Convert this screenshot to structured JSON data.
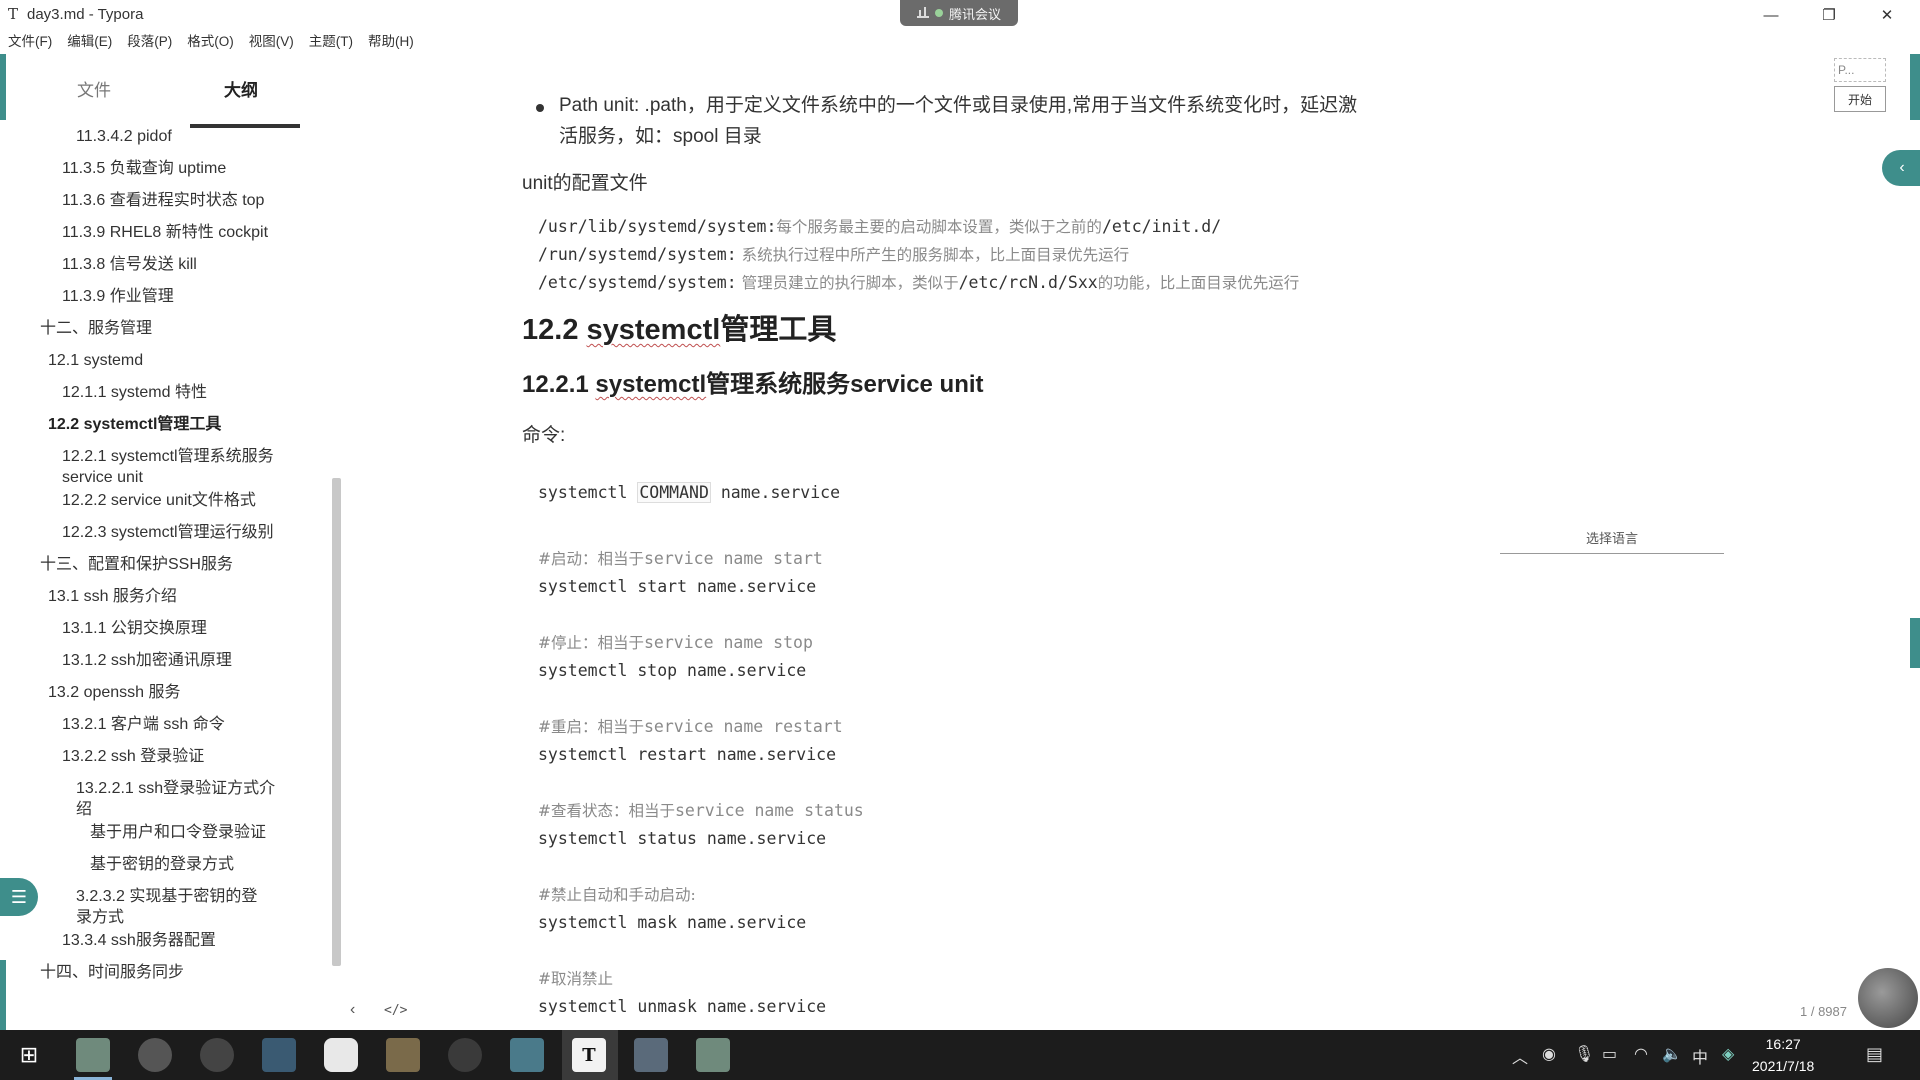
{
  "window": {
    "app_icon": "T",
    "title": "day3.md - Typora",
    "meeting_badge": "腾讯会议",
    "minimize": "—",
    "maximize": "❐",
    "close": "✕"
  },
  "menu": [
    "文件(F)",
    "编辑(E)",
    "段落(P)",
    "格式(O)",
    "视图(V)",
    "主题(T)",
    "帮助(H)"
  ],
  "sidebar": {
    "tab_files": "文件",
    "tab_outline": "大纲",
    "toggle_icon": "☰",
    "nav_back": "‹",
    "nav_code": "</>",
    "items": [
      {
        "label": "11.3.4.2 pidof",
        "level": 4,
        "bold": false
      },
      {
        "label": "11.3.5 负载查询 uptime",
        "level": 3,
        "bold": false
      },
      {
        "label": "11.3.6 查看进程实时状态 top",
        "level": 3,
        "bold": false
      },
      {
        "label": "11.3.9 RHEL8 新特性 cockpit",
        "level": 3,
        "bold": false
      },
      {
        "label": "11.3.8 信号发送 kill",
        "level": 3,
        "bold": false
      },
      {
        "label": "11.3.9 作业管理",
        "level": 3,
        "bold": false
      },
      {
        "label": "十二、服务管理",
        "level": 1,
        "bold": false
      },
      {
        "label": "12.1 systemd",
        "level": 2,
        "bold": false
      },
      {
        "label": "12.1.1 systemd 特性",
        "level": 3,
        "bold": false
      },
      {
        "label": "12.2 systemctl管理工具",
        "level": 2,
        "bold": true
      },
      {
        "label": "12.2.1 systemctl管理系统服务",
        "label2": "service unit",
        "level": 3,
        "bold": false
      },
      {
        "label": "12.2.2 service unit文件格式",
        "level": 3,
        "bold": false
      },
      {
        "label": "12.2.3 systemctl管理运行级别",
        "level": 3,
        "bold": false
      },
      {
        "label": "十三、配置和保护SSH服务",
        "level": 1,
        "bold": false
      },
      {
        "label": "13.1 ssh 服务介绍",
        "level": 2,
        "bold": false
      },
      {
        "label": "13.1.1 公钥交换原理",
        "level": 3,
        "bold": false
      },
      {
        "label": "13.1.2 ssh加密通讯原理",
        "level": 3,
        "bold": false
      },
      {
        "label": "13.2 openssh 服务",
        "level": 2,
        "bold": false
      },
      {
        "label": "13.2.1 客户端 ssh 命令",
        "level": 3,
        "bold": false
      },
      {
        "label": "13.2.2 ssh 登录验证",
        "level": 3,
        "bold": false
      },
      {
        "label": "13.2.2.1 ssh登录验证方式介",
        "label2": "绍",
        "level": 4,
        "bold": false
      },
      {
        "label": "基于用户和口令登录验证",
        "level": 5,
        "bold": false
      },
      {
        "label": "基于密钥的登录方式",
        "level": 5,
        "bold": false
      },
      {
        "label": "3.2.3.2 实现基于密钥的登",
        "label2": "录方式",
        "level": 4,
        "bold": false
      },
      {
        "label": "13.3.4 ssh服务器配置",
        "level": 3,
        "bold": false
      },
      {
        "label": "十四、时间服务同步",
        "level": 1,
        "bold": false
      }
    ]
  },
  "doc": {
    "bullet_line1": "Path unit: .path，用于定义文件系统中的一个文件或目录使用,常用于当文件系统变化时，延迟激",
    "bullet_line2": "活服务，如：spool 目录",
    "unit_config_title": "unit的配置文件",
    "config_lines": [
      {
        "path": "/usr/lib/systemd/system:",
        "comment": "每个服务最主要的启动脚本设置，类似于之前的",
        "tail": "/etc/init.d/",
        "tail_comment": ""
      },
      {
        "path": "/run/systemd/system:",
        "comment": " 系统执行过程中所产生的服务脚本，比上面目录优先运行",
        "tail": "",
        "tail_comment": ""
      },
      {
        "path": "/etc/systemd/system:",
        "comment": " 管理员建立的执行脚本，类似于",
        "tail": "/etc/rcN.d/Sxx",
        "tail_comment": "的功能，比上面目录优先运行"
      }
    ],
    "h2_prefix": "12.2 ",
    "h2_squig": "systemctl",
    "h2_suffix": "管理工具",
    "h3_prefix": "12.2.1 ",
    "h3_squig": "systemctl",
    "h3_suffix": "管理系统服务service unit",
    "command_label": "命令:",
    "cmd_prefix": "systemctl ",
    "cmd_box": "COMMAND",
    "cmd_suffix": " name.service",
    "blocks": [
      {
        "comment_cn": "#启动：相当于",
        "comment_code": "service name start",
        "command": "systemctl start name.service"
      },
      {
        "comment_cn": "#停止：相当于",
        "comment_code": "service name stop",
        "command": "systemctl stop name.service"
      },
      {
        "comment_cn": "#重启：相当于",
        "comment_code": "service name restart",
        "command": "systemctl restart name.service"
      },
      {
        "comment_cn": "#查看状态：相当于",
        "comment_code": "service name status",
        "command": "systemctl status name.service"
      },
      {
        "comment_cn": "#禁止自动和手动启动:",
        "comment_code": "",
        "command": "systemctl mask name.service"
      },
      {
        "comment_cn": "#取消禁止",
        "comment_code": "",
        "command": "systemctl unmask name.service"
      }
    ]
  },
  "right_panel": {
    "p_label": "P...",
    "start_button": "开始",
    "collapse_icon": "‹",
    "language_select": "选择语言",
    "word_count": "1 / 8987"
  },
  "taskbar": {
    "start_icon": "⊞",
    "time": "16:27",
    "date": "2021/7/18",
    "ime": "中",
    "notification_icon": "▤"
  },
  "colors": {
    "accent": "#3e8e8b",
    "taskbar": "#1c1c1c",
    "comment": "#8a8a8a"
  }
}
